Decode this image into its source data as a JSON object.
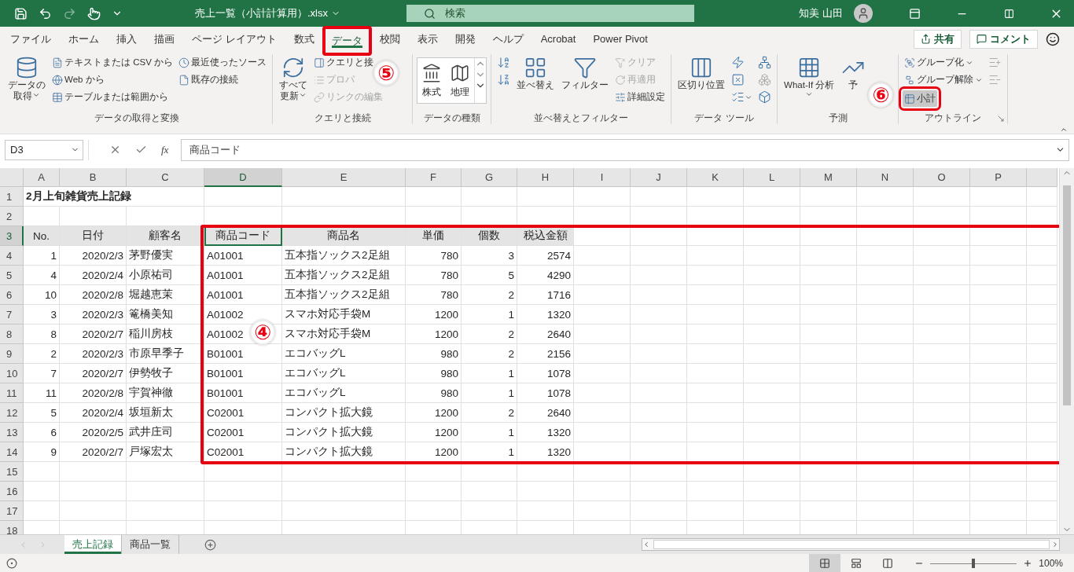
{
  "title_bar": {
    "file_name": "売上一覧（小計計算用）.xlsx",
    "search": {
      "placeholder": "検索"
    },
    "user_name": "知美 山田"
  },
  "ribbon_tabs": [
    {
      "label": "ファイル",
      "selected": false,
      "framed": false
    },
    {
      "label": "ホーム",
      "selected": false,
      "framed": false
    },
    {
      "label": "挿入",
      "selected": false,
      "framed": false
    },
    {
      "label": "描画",
      "selected": false,
      "framed": false
    },
    {
      "label": "ページ レイアウト",
      "selected": false,
      "framed": false
    },
    {
      "label": "数式",
      "selected": false,
      "framed": false
    },
    {
      "label": "データ",
      "selected": true,
      "framed": true
    },
    {
      "label": "校閲",
      "selected": false,
      "framed": false
    },
    {
      "label": "表示",
      "selected": false,
      "framed": false
    },
    {
      "label": "開発",
      "selected": false,
      "framed": false
    },
    {
      "label": "ヘルプ",
      "selected": false,
      "framed": false
    },
    {
      "label": "Acrobat",
      "selected": false,
      "framed": false
    },
    {
      "label": "Power Pivot",
      "selected": false,
      "framed": false
    }
  ],
  "share_button": "共有",
  "comment_button": "コメント",
  "ribbon_groups": [
    {
      "label": "データの取得と変換",
      "columns": [
        {
          "items": [
            {
              "kind": "large",
              "lines": [
                "データの",
                "取得"
              ],
              "dropdown": true,
              "disabled": false,
              "framed": false
            }
          ]
        },
        {
          "items": [
            {
              "kind": "small",
              "label": "テキストまたは CSV から",
              "dropdown": false,
              "disabled": false,
              "framed": false
            },
            {
              "kind": "small",
              "label": "Web から",
              "dropdown": false,
              "disabled": false,
              "framed": false
            },
            {
              "kind": "small",
              "label": "テーブルまたは範囲から",
              "dropdown": false,
              "disabled": false,
              "framed": false
            }
          ]
        },
        {
          "items": [
            {
              "kind": "small",
              "label": "最近使ったソース",
              "dropdown": false,
              "disabled": false,
              "framed": false
            },
            {
              "kind": "small",
              "label": "既存の接続",
              "dropdown": false,
              "disabled": false,
              "framed": false
            }
          ]
        }
      ]
    },
    {
      "label": "クエリと接続",
      "columns": [
        {
          "items": [
            {
              "kind": "large",
              "lines": [
                "すべて",
                "更新"
              ],
              "dropdown": true,
              "disabled": false,
              "framed": false
            }
          ]
        },
        {
          "items": [
            {
              "kind": "small",
              "label": "クエリと接",
              "dropdown": false,
              "disabled": false,
              "framed": false
            },
            {
              "kind": "small",
              "label": "プロパ",
              "dropdown": false,
              "disabled": true,
              "framed": false
            },
            {
              "kind": "small",
              "label": "リンクの編集",
              "dropdown": false,
              "disabled": true,
              "framed": false
            }
          ]
        }
      ]
    },
    {
      "label": "データの種類",
      "columns": [
        {
          "items": [
            {
              "kind": "gallery",
              "labels": [
                "株式",
                "地理"
              ],
              "dropdown": false,
              "disabled": false,
              "framed": false
            }
          ]
        }
      ]
    },
    {
      "label": "並べ替えとフィルター",
      "columns": [
        {
          "items": [
            {
              "kind": "icon",
              "dropdown": false,
              "disabled": false,
              "framed": false
            },
            {
              "kind": "icon",
              "dropdown": false,
              "disabled": false,
              "framed": false
            }
          ]
        },
        {
          "items": [
            {
              "kind": "large",
              "lines": [
                "並べ替え"
              ],
              "dropdown": false,
              "disabled": false,
              "framed": false
            }
          ]
        },
        {
          "items": [
            {
              "kind": "large",
              "lines": [
                "フィルター"
              ],
              "dropdown": false,
              "disabled": false,
              "framed": false
            }
          ]
        },
        {
          "items": [
            {
              "kind": "small",
              "label": "クリア",
              "dropdown": false,
              "disabled": true,
              "framed": false
            },
            {
              "kind": "small",
              "label": "再適用",
              "dropdown": false,
              "disabled": true,
              "framed": false
            },
            {
              "kind": "small",
              "label": "詳細設定",
              "dropdown": false,
              "disabled": false,
              "framed": false
            }
          ]
        }
      ]
    },
    {
      "label": "データ ツール",
      "columns": [
        {
          "items": [
            {
              "kind": "large",
              "lines": [
                "区切り位置"
              ],
              "dropdown": false,
              "disabled": false,
              "framed": false
            }
          ]
        },
        {
          "items": [
            {
              "kind": "icon",
              "dropdown": false,
              "disabled": false,
              "framed": false
            },
            {
              "kind": "icon",
              "dropdown": false,
              "disabled": false,
              "framed": false
            },
            {
              "kind": "icon",
              "dropdown": true,
              "disabled": false,
              "framed": false
            }
          ]
        },
        {
          "items": [
            {
              "kind": "icon",
              "dropdown": false,
              "disabled": false,
              "framed": false
            },
            {
              "kind": "icon",
              "dropdown": false,
              "disabled": true,
              "framed": false
            },
            {
              "kind": "icon",
              "dropdown": false,
              "disabled": false,
              "framed": false
            }
          ]
        }
      ]
    },
    {
      "label": "予測",
      "columns": [
        {
          "items": [
            {
              "kind": "large",
              "lines": [
                "What-If 分析"
              ],
              "dropdown": true,
              "disabled": false,
              "framed": false
            }
          ]
        },
        {
          "items": [
            {
              "kind": "large",
              "lines": [
                "予"
              ],
              "dropdown": false,
              "disabled": false,
              "framed": false
            }
          ]
        }
      ]
    },
    {
      "label": "アウトライン",
      "launcher": true,
      "columns": [
        {
          "items": [
            {
              "kind": "small",
              "label": "グループ化",
              "dropdown": true,
              "disabled": false,
              "framed": false
            },
            {
              "kind": "small",
              "label": "グループ解除",
              "dropdown": true,
              "disabled": false,
              "framed": false
            },
            {
              "kind": "small",
              "label": "小計",
              "dropdown": false,
              "disabled": false,
              "framed": true
            }
          ]
        },
        {
          "items": [
            {
              "kind": "icon",
              "dropdown": false,
              "disabled": true,
              "framed": false
            },
            {
              "kind": "icon",
              "dropdown": false,
              "disabled": true,
              "framed": false
            }
          ]
        }
      ]
    }
  ],
  "formula_bar": {
    "name_box": "D3",
    "function_label": "fx",
    "formula": "商品コード"
  },
  "sheet": {
    "columns": [
      {
        "label": "A",
        "selected": false,
        "numeric": true
      },
      {
        "label": "B",
        "selected": false,
        "numeric": true
      },
      {
        "label": "C",
        "selected": false,
        "numeric": false
      },
      {
        "label": "D",
        "selected": true,
        "numeric": false,
        "framed": true
      },
      {
        "label": "E",
        "selected": false,
        "numeric": false
      },
      {
        "label": "F",
        "selected": false,
        "numeric": true
      },
      {
        "label": "G",
        "selected": false,
        "numeric": true
      },
      {
        "label": "H",
        "selected": false,
        "numeric": true
      },
      {
        "label": "I",
        "selected": false
      },
      {
        "label": "J",
        "selected": false
      },
      {
        "label": "K",
        "selected": false
      },
      {
        "label": "L",
        "selected": false
      },
      {
        "label": "M",
        "selected": false
      },
      {
        "label": "N",
        "selected": false
      },
      {
        "label": "O",
        "selected": false
      },
      {
        "label": "P",
        "selected": false
      },
      {
        "selected": false
      }
    ],
    "rows": [
      {
        "number": "1",
        "kind": "title",
        "selected": false,
        "cells": [
          "2月上旬雑貨売上記録"
        ]
      },
      {
        "number": "2",
        "kind": "empty",
        "selected": false
      },
      {
        "number": "3",
        "kind": "header",
        "selected": true,
        "cells": [
          "No.",
          "日付",
          "顧客名",
          "商品コード",
          "商品名",
          "単価",
          "個数",
          "税込金額"
        ]
      },
      {
        "number": "4",
        "kind": "data",
        "selected": false,
        "cells": [
          "1",
          "2020/2/3",
          "茅野優実",
          "A01001",
          "五本指ソックス2足組",
          "780",
          "3",
          "2574"
        ]
      },
      {
        "number": "5",
        "kind": "data",
        "selected": false,
        "cells": [
          "4",
          "2020/2/4",
          "小原祐司",
          "A01001",
          "五本指ソックス2足組",
          "780",
          "5",
          "4290"
        ]
      },
      {
        "number": "6",
        "kind": "data",
        "selected": false,
        "cells": [
          "10",
          "2020/2/8",
          "堀越恵茉",
          "A01001",
          "五本指ソックス2足組",
          "780",
          "2",
          "1716"
        ]
      },
      {
        "number": "7",
        "kind": "data",
        "selected": false,
        "cells": [
          "3",
          "2020/2/3",
          "篭橋美知",
          "A01002",
          "スマホ対応手袋M",
          "1200",
          "1",
          "1320"
        ]
      },
      {
        "number": "8",
        "kind": "data",
        "selected": false,
        "cells": [
          "8",
          "2020/2/7",
          "稲川房枝",
          "A01002",
          "スマホ対応手袋M",
          "1200",
          "2",
          "2640"
        ]
      },
      {
        "number": "9",
        "kind": "data",
        "selected": false,
        "cells": [
          "2",
          "2020/2/3",
          "市原早季子",
          "B01001",
          "エコバッグL",
          "980",
          "2",
          "2156"
        ]
      },
      {
        "number": "10",
        "kind": "data",
        "selected": false,
        "cells": [
          "7",
          "2020/2/7",
          "伊勢牧子",
          "B01001",
          "エコバッグL",
          "980",
          "1",
          "1078"
        ]
      },
      {
        "number": "11",
        "kind": "data",
        "selected": false,
        "cells": [
          "11",
          "2020/2/8",
          "宇賀神徹",
          "B01001",
          "エコバッグL",
          "980",
          "1",
          "1078"
        ]
      },
      {
        "number": "12",
        "kind": "data",
        "selected": false,
        "cells": [
          "5",
          "2020/2/4",
          "坂垣新太",
          "C02001",
          "コンパクト拡大鏡",
          "1200",
          "2",
          "2640"
        ]
      },
      {
        "number": "13",
        "kind": "data",
        "selected": false,
        "cells": [
          "6",
          "2020/2/5",
          "武井庄司",
          "C02001",
          "コンパクト拡大鏡",
          "1200",
          "1",
          "1320"
        ]
      },
      {
        "number": "14",
        "kind": "data",
        "selected": false,
        "cells": [
          "9",
          "2020/2/7",
          "戸塚宏太",
          "C02001",
          "コンパクト拡大鏡",
          "1200",
          "1",
          "1320"
        ]
      },
      {
        "number": "15",
        "kind": "empty",
        "selected": false
      },
      {
        "number": "16",
        "kind": "empty",
        "selected": false
      },
      {
        "number": "17",
        "kind": "empty",
        "selected": false
      },
      {
        "number": "18",
        "kind": "empty",
        "selected": false
      }
    ]
  },
  "sheet_tabs": [
    {
      "label": "売上記録",
      "selected": true
    },
    {
      "label": "商品一覧",
      "selected": false
    }
  ],
  "status_bar": {
    "views": [
      {
        "selected": true
      },
      {
        "selected": false
      },
      {
        "selected": false
      }
    ],
    "zoom": {
      "level": 0.5,
      "reading": "100%"
    }
  },
  "annotations": [
    {
      "text": "⑤"
    },
    {
      "text": "⑥"
    },
    {
      "text": "④"
    }
  ]
}
